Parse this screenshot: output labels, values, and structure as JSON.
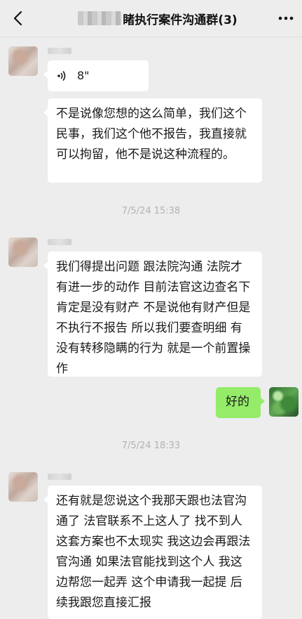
{
  "header": {
    "title": "睹执行案件沟通群(3)"
  },
  "messages": {
    "voice_duration": "8\"",
    "msg1": "不是说像您想的这么简单，我们这个民事，我们这个他不报告，我直接就可以拘留，他不是说这种流程的。",
    "ts1": "7/5/24 15:38",
    "msg2": "我们得提出问题 跟法院沟通 法院才有进一步的动作 目前法官这边查名下肯定是没有财产 不是说他有财产但是不执行不报告 所以我们要查明细 有没有转移隐瞒的行为 就是一个前置操作",
    "reply": "好的",
    "ts2": "7/5/24 18:33",
    "msg3": "还有就是您说这个我那天跟也法官沟通了 法官联系不上这人了 找不到人 这套方案也不太现实 我这边会再跟法官沟通 如果法官能找到这个人 我这边帮您一起弄 这个申请我一起提 后续我跟您直接汇报"
  },
  "colors": {
    "background": "#ededed",
    "incoming_bubble": "#ffffff",
    "outgoing_bubble": "#95ec69",
    "timestamp": "#b2b2b2"
  },
  "icons": {
    "back": "chevron-left-icon",
    "more": "more-dots-icon",
    "voice": "voice-wave-icon"
  }
}
